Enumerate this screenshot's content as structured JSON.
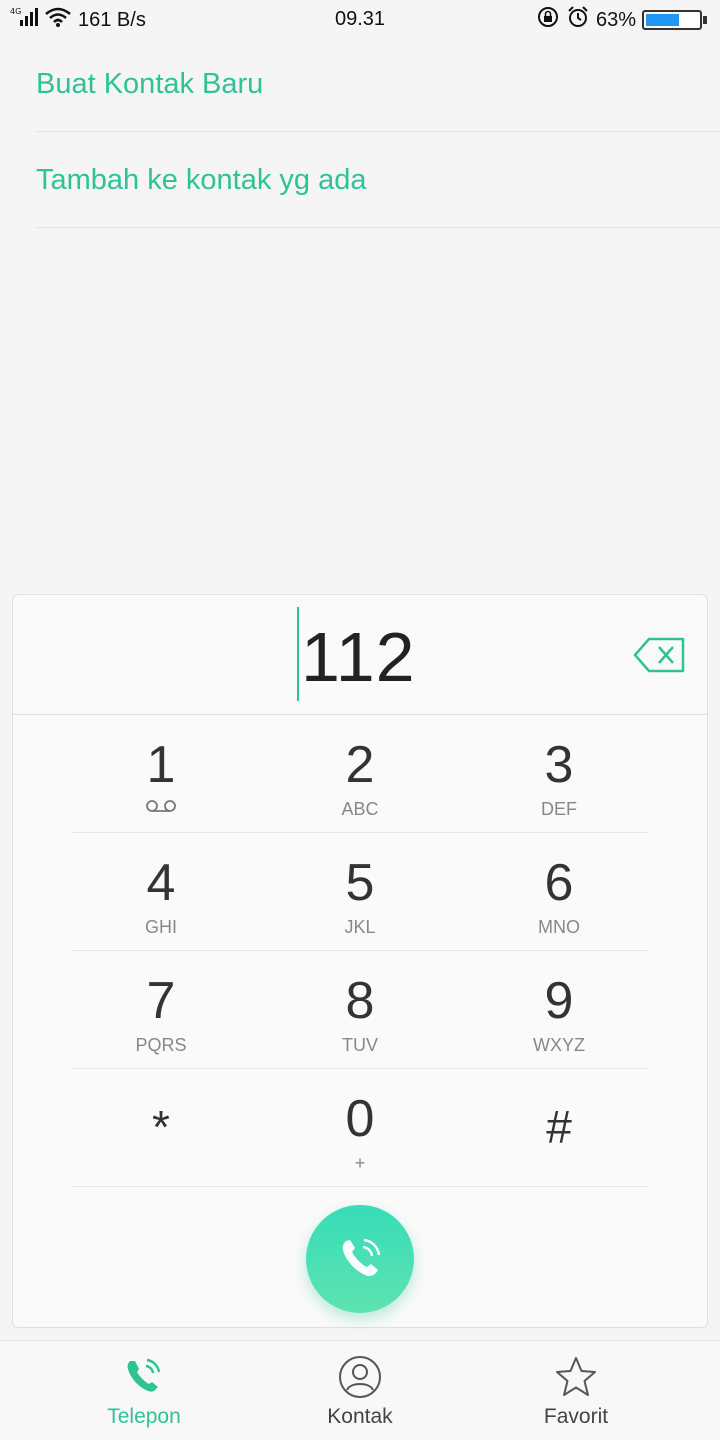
{
  "status_bar": {
    "network": "4G",
    "speed": "161 B/s",
    "time": "09.31",
    "battery": "63%",
    "battery_level": 0.63,
    "icons": [
      "signal-icon",
      "wifi-icon",
      "rotation-lock-icon",
      "alarm-icon",
      "battery-icon"
    ]
  },
  "options": {
    "create_contact": "Buat Kontak Baru",
    "add_to_existing": "Tambah ke kontak yg ada"
  },
  "dialer": {
    "number": "112",
    "keys": [
      {
        "digit": "1",
        "letters": ""
      },
      {
        "digit": "2",
        "letters": "ABC"
      },
      {
        "digit": "3",
        "letters": "DEF"
      },
      {
        "digit": "4",
        "letters": "GHI"
      },
      {
        "digit": "5",
        "letters": "JKL"
      },
      {
        "digit": "6",
        "letters": "MNO"
      },
      {
        "digit": "7",
        "letters": "PQRS"
      },
      {
        "digit": "8",
        "letters": "TUV"
      },
      {
        "digit": "9",
        "letters": "WXYZ"
      },
      {
        "digit": "*",
        "letters": ""
      },
      {
        "digit": "0",
        "letters": "+"
      },
      {
        "digit": "#",
        "letters": ""
      }
    ]
  },
  "nav": {
    "telepon": "Telepon",
    "kontak": "Kontak",
    "favorit": "Favorit"
  },
  "colors": {
    "accent": "#2fc394",
    "call_button": "#3fdcb6"
  }
}
